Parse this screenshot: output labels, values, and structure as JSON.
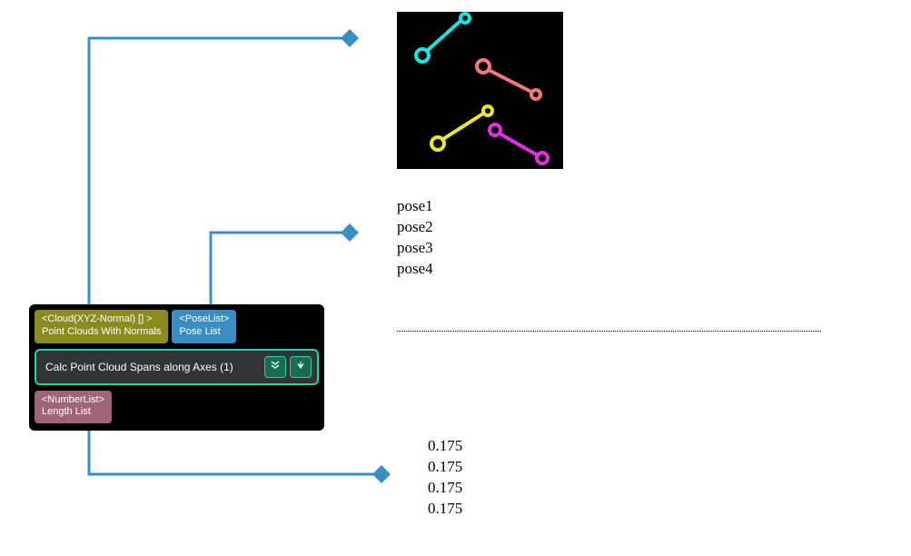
{
  "node": {
    "input1": {
      "type": "<Cloud(XYZ-Normal) [] >",
      "label": "Point Clouds With Normals"
    },
    "input2": {
      "type": "<PoseList>",
      "label": "Pose List"
    },
    "title": "Calc Point Cloud Spans along Axes (1)",
    "output1": {
      "type": "<NumberList>",
      "label": "Length List"
    },
    "buttons": {
      "expand": "expand-icon",
      "download": "download-icon"
    }
  },
  "pose_list": {
    "items": [
      "pose1",
      "pose2",
      "pose3",
      "pose4"
    ]
  },
  "number_list": {
    "items": [
      "0.175",
      "0.175",
      "0.175",
      "0.175"
    ]
  },
  "thumb": {
    "description": "segmented-point-clouds-preview",
    "colors": {
      "rod1": "#19e3e3",
      "rod2": "#f07a7a",
      "rod3": "#f0e628",
      "rod4": "#e030e0"
    }
  }
}
